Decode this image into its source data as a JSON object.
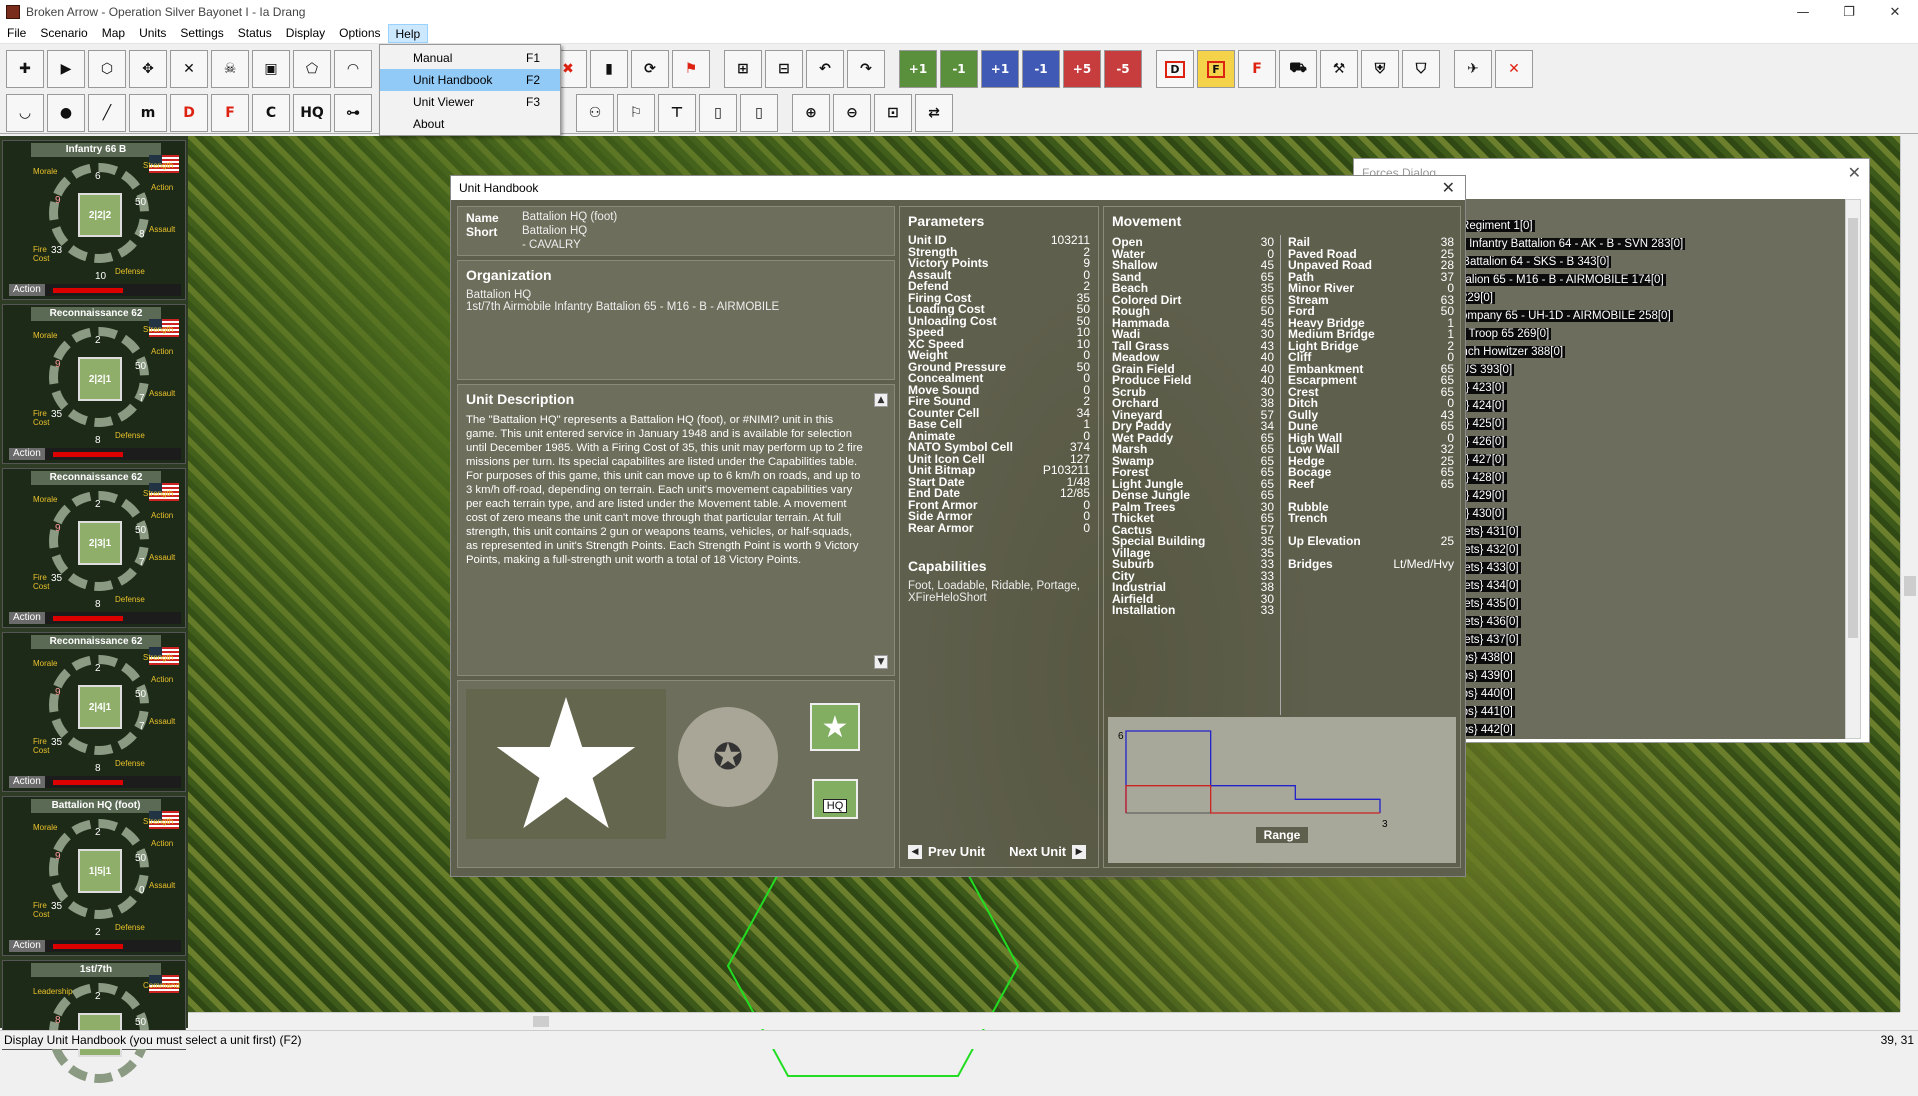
{
  "window": {
    "title": "Broken Arrow - Operation Silver Bayonet I - Ia Drang",
    "minimize": "—",
    "restore": "❐",
    "close": "✕"
  },
  "menu": [
    "File",
    "Scenario",
    "Map",
    "Units",
    "Settings",
    "Status",
    "Display",
    "Options",
    "Help"
  ],
  "help_menu": [
    {
      "label": "Manual",
      "key": "F1"
    },
    {
      "label": "Unit Handbook",
      "key": "F2"
    },
    {
      "label": "Unit Viewer",
      "key": "F3"
    },
    {
      "label": "About",
      "key": ""
    }
  ],
  "toolbar": {
    "row1": [
      "+1",
      "-1",
      "+1",
      "-1",
      "+5",
      "-5",
      "D",
      "F",
      "F"
    ],
    "row2": [
      "D",
      "F",
      "C",
      "HQ"
    ]
  },
  "unit_cards": [
    {
      "name": "Infantry 66 B",
      "top_num": "6",
      "left_num": "9",
      "right_num": "50",
      "right2": "8",
      "bl": "33",
      "bottom": "10",
      "core": "2|2|2",
      "br": "",
      "action": "Action"
    },
    {
      "name": "Reconnaissance 62",
      "top_num": "2",
      "left_num": "9",
      "right_num": "50",
      "right2": "7",
      "bl": "35",
      "bottom": "8",
      "core": "2|2|1",
      "br": "",
      "action": "Action"
    },
    {
      "name": "Reconnaissance 62",
      "top_num": "2",
      "left_num": "9",
      "right_num": "50",
      "right2": "7",
      "bl": "35",
      "bottom": "8",
      "core": "2|3|1",
      "br": "",
      "action": "Action"
    },
    {
      "name": "Reconnaissance 62",
      "top_num": "2",
      "left_num": "9",
      "right_num": "50",
      "right2": "7",
      "bl": "35",
      "bottom": "8",
      "core": "2|4|1",
      "br": "",
      "action": "Action"
    },
    {
      "name": "Battalion HQ (foot)",
      "top_num": "2",
      "left_num": "9",
      "right_num": "50",
      "right2": "0",
      "bl": "35",
      "bottom": "2",
      "core": "1|5|1",
      "br": "",
      "action": "Action"
    },
    {
      "name": "1st/7th",
      "top_num": "2",
      "left_num": "8",
      "right_num": "50",
      "right2": "",
      "bl": "",
      "bottom": "",
      "core": "",
      "br": "",
      "action": ""
    }
  ],
  "card_labels": {
    "morale": "Morale",
    "strength": "Strength",
    "action": "Action",
    "assault": "Assault",
    "fire_cost": "Fire Cost",
    "defense": "Defense",
    "leadership": "Leadership",
    "command": "Command"
  },
  "forces": {
    "title": "Forces Dialog",
    "items": [
      "izations",
      "Regular Infantry Regiment 1[0]",
      "R33 NVA Regular Infantry Battalion 64 - AK - B - SVN 283[0]",
      "in Force Infantry Battalion 64 - SKS - B 343[0]",
      "obile Infantry Battalion 65 - M16 - B - AIRMOBILE 174[0]",
      "t Base FALCON 229[0]",
      "ault Helicopter Company 65 - UH-1D  - AIRMOBILE 258[0]",
      "avalry Air Cavalry Troop 65  269[0]",
      "ery 65 - M115 8 inch Howitzer 388[0]",
      "t Base COLUMBUS 393[0]",
      "I Skyraider {Guns} 423[0]",
      "I Skyraider {Guns} 424[0]",
      "I Skyraider {Guns} 425[0]",
      "I Skyraider {Guns} 426[0]",
      "I Skyraider {Guns} 427[0]",
      "I Skyraider {Guns} 428[0]",
      "I Skyraider {Guns} 429[0]",
      "I Skyraider {Guns} 430[0]",
      "I Skyraider {Rockets} 431[0]",
      "I Skyraider {Rockets} 432[0]",
      "I Skyraider {Rockets} 433[0]",
      "I Skyraider {Rockets} 434[0]",
      "I Skyraider {Rockets} 435[0]",
      "I Skyraider {Rockets} 436[0]",
      "I Skyraider {Rockets} 437[0]",
      "I Skyraider {Bombs} 438[0]",
      "I Skyraider {Bombs} 439[0]",
      "I Skyraider {Bombs} 440[0]",
      "I Skyraider {Bombs} 441[0]",
      "I Skyraider {Bombs} 442[0]"
    ]
  },
  "handbook": {
    "title": "Unit Handbook",
    "name_label": "Name",
    "name": "Battalion HQ (foot)",
    "short_label": "Short",
    "short": "Battalion HQ",
    "short2": "- CAVALRY",
    "org_heading": "Organization",
    "org1": "Battalion HQ",
    "org2": "1st/7th Airmobile Infantry Battalion 65 - M16 - B - AIRMOBILE",
    "desc_heading": "Unit Description",
    "description": "The \"Battalion HQ\" represents a Battalion HQ (foot), or #NIMI? unit in this game. This unit entered service in January 1948 and is available for selection until December 1985. With a Firing Cost of 35, this unit may perform up to 2 fire missions per turn. Its special capabilites are listed under the Capabilities table. For purposes of this game, this unit can move up to 6 km/h on roads, and up to 3 km/h off-road, depending on terrain. Each unit's movement capabilities vary per each terrain type, and are listed under the Movement table. A movement cost of zero means the unit can't move through that particular terrain. At full strength, this unit contains 2 gun or weapons teams, vehicles, or half-squads, as represented in unit's Strength Points. Each Strength Point is worth 9 Victory Points, making a full-strength unit worth a total of 18 Victory Points.",
    "params_heading": "Parameters",
    "params": [
      [
        "Unit ID",
        "103211"
      ],
      [
        "Strength",
        "2"
      ],
      [
        "Victory Points",
        "9"
      ],
      [
        "Assault",
        "0"
      ],
      [
        "Defend",
        "2"
      ],
      [
        "Firing Cost",
        "35"
      ],
      [
        "Loading Cost",
        "50"
      ],
      [
        "Unloading Cost",
        "50"
      ],
      [
        "Speed",
        "10"
      ],
      [
        "XC Speed",
        "10"
      ],
      [
        "Weight",
        "0"
      ],
      [
        "Ground Pressure",
        "50"
      ],
      [
        "Concealment",
        "0"
      ],
      [
        "Move Sound",
        "0"
      ],
      [
        "Fire Sound",
        "2"
      ],
      [
        "Counter Cell",
        "34"
      ],
      [
        "Base Cell",
        "1"
      ],
      [
        "Animate",
        "0"
      ],
      [
        "NATO Symbol Cell",
        "374"
      ],
      [
        "Unit Icon Cell",
        "127"
      ],
      [
        "Unit Bitmap",
        "P103211"
      ],
      [
        "Start Date",
        "1/48"
      ],
      [
        "End Date",
        "12/85"
      ],
      [
        "Front Armor",
        "0"
      ],
      [
        "Side Armor",
        "0"
      ],
      [
        "Rear Armor",
        "0"
      ]
    ],
    "cap_heading": "Capabilities",
    "capabilities": "Foot, Loadable, Ridable, Portage, XFireHeloShort",
    "prev": "Prev Unit",
    "next": "Next Unit",
    "move_heading": "Movement",
    "move1": [
      [
        "Open",
        "30"
      ],
      [
        "Water",
        "0"
      ],
      [
        "Shallow",
        "45"
      ],
      [
        "Sand",
        "65"
      ],
      [
        "Beach",
        "35"
      ],
      [
        "Colored Dirt",
        "65"
      ],
      [
        "Rough",
        "50"
      ],
      [
        "Hammada",
        "45"
      ],
      [
        "Wadi",
        "30"
      ],
      [
        "Tall Grass",
        "43"
      ],
      [
        "Meadow",
        "40"
      ],
      [
        "Grain Field",
        "40"
      ],
      [
        "Produce Field",
        "40"
      ],
      [
        "Scrub",
        "30"
      ],
      [
        "Orchard",
        "38"
      ],
      [
        "Vineyard",
        "57"
      ],
      [
        "Dry Paddy",
        "34"
      ],
      [
        "Wet Paddy",
        "65"
      ],
      [
        "Marsh",
        "65"
      ],
      [
        "Swamp",
        "65"
      ],
      [
        "Forest",
        "65"
      ],
      [
        "Light Jungle",
        "65"
      ],
      [
        "Dense Jungle",
        "65"
      ],
      [
        "Palm Trees",
        "30"
      ],
      [
        "Thicket",
        "65"
      ],
      [
        "Cactus",
        "57"
      ],
      [
        "Special Building",
        "35"
      ],
      [
        "Village",
        "35"
      ],
      [
        "Suburb",
        "33"
      ],
      [
        "City",
        "33"
      ],
      [
        "Industrial",
        "38"
      ],
      [
        "Airfield",
        "30"
      ],
      [
        "Installation",
        "33"
      ]
    ],
    "move2": [
      [
        "Rail",
        "38"
      ],
      [
        "Paved Road",
        "25"
      ],
      [
        "Unpaved Road",
        "28"
      ],
      [
        "Path",
        "37"
      ],
      [
        "Minor River",
        "0"
      ],
      [
        "Stream",
        "63"
      ],
      [
        "Ford",
        "50"
      ],
      [
        "Heavy Bridge",
        "1"
      ],
      [
        "Medium Bridge",
        "1"
      ],
      [
        "Light Bridge",
        "2"
      ],
      [
        "Cliff",
        "0"
      ],
      [
        "Embankment",
        "65"
      ],
      [
        "Escarpment",
        "65"
      ],
      [
        "Crest",
        "65"
      ],
      [
        "Ditch",
        "0"
      ],
      [
        "Gully",
        "43"
      ],
      [
        "Dune",
        "65"
      ],
      [
        "High Wall",
        "0"
      ],
      [
        "Low Wall",
        "32"
      ],
      [
        "Hedge",
        "25"
      ],
      [
        "Bocage",
        "65"
      ],
      [
        "Reef",
        "65"
      ],
      [
        "",
        ""
      ],
      [
        "Rubble",
        ""
      ],
      [
        "Trench",
        ""
      ],
      [
        "",
        ""
      ],
      [
        "Up Elevation",
        "25"
      ],
      [
        "",
        ""
      ],
      [
        "Bridges",
        "Lt/Med/Hvy"
      ]
    ],
    "range_label": "Range",
    "chart_y": "6",
    "chart_x": "3",
    "hq_label": "HQ"
  },
  "chart_data": {
    "type": "line",
    "xlabel": "Range",
    "x": [
      0,
      1,
      2,
      3
    ],
    "series": [
      {
        "color": "#2222cc",
        "values": [
          6,
          2,
          1,
          0
        ]
      },
      {
        "color": "#cc2222",
        "values": [
          2,
          0,
          0,
          0
        ]
      }
    ],
    "ylim": [
      0,
      6
    ],
    "xlim": [
      0,
      3
    ]
  },
  "status": {
    "left": "Display Unit Handbook (you must select a unit first) (F2)",
    "right": "39, 31"
  }
}
